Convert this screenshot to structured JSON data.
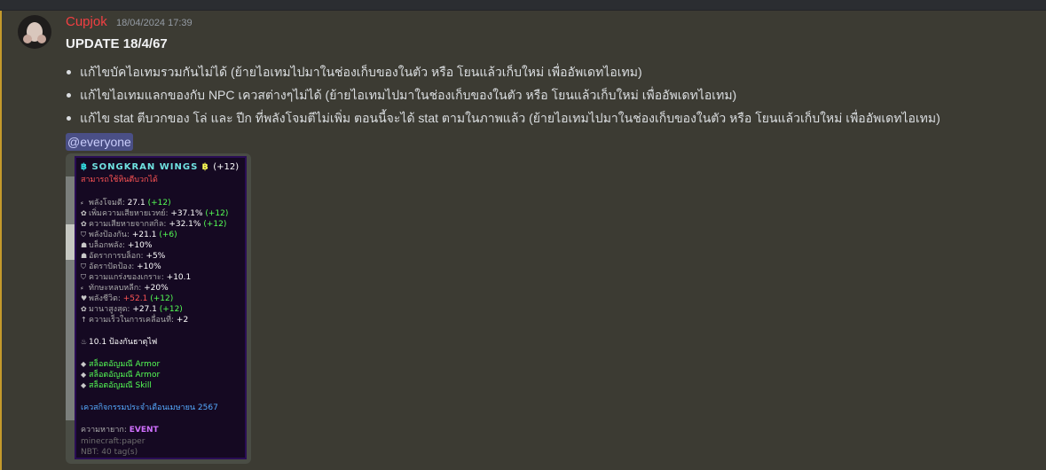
{
  "message": {
    "username": "Cupjok",
    "timestamp": "18/04/2024 17:39",
    "title": "UPDATE 18/4/67",
    "bullets": [
      "แก้ไขบัคไอเทมรวมกันไม่ได้ (ย้ายไอเทมไปมาในช่องเก็บของในตัว หรือ โยนแล้วเก็บใหม่ เพื่ออัพเดทไอเทม)",
      "แก้ไขไอเทมแลกของกับ NPC เควสต่างๆไม่ได้ (ย้ายไอเทมไปมาในช่องเก็บของในตัว หรือ โยนแล้วเก็บใหม่ เพื่ออัพเดทไอเทม)",
      "แก้ไข stat ตีบวกของ โล่ และ ปีก ที่พลังโจมตีไม่เพิ่ม  ตอนนี้จะได้ stat ตามในภาพแล้ว (ย้ายไอเทมไปมาในช่องเก็บของในตัว หรือ โยนแล้วเก็บใหม่ เพื่ออัพเดทไอเทม)"
    ],
    "mention": "@everyone"
  },
  "tooltip": {
    "title_icon": "฿",
    "title_name": "SONGKRAN WINGS",
    "title_icon2": "฿",
    "title_plus": "(+12)",
    "subtitle": "สามารถใช้หินตีบวกได้",
    "stats": [
      {
        "icon": "⸗",
        "label": "พลังโจมตี:",
        "value": "27.1",
        "bonus": "(+12)"
      },
      {
        "icon": "✿",
        "label": "เพิ่มความเสียหายเวทย์:",
        "value": "+37.1%",
        "bonus": "(+12)"
      },
      {
        "icon": "✿",
        "label": "ความเสียหายจากสกิล:",
        "value": "+32.1%",
        "bonus": "(+12)"
      },
      {
        "icon": "⛉",
        "label": "พลังป้องกัน:",
        "value": "+21.1",
        "bonus": "(+6)"
      },
      {
        "icon": "☗",
        "label": "บล็อกพลัง:",
        "value": "+10%",
        "bonus": ""
      },
      {
        "icon": "☗",
        "label": "อัตราการบล็อก:",
        "value": "+5%",
        "bonus": ""
      },
      {
        "icon": "⛉",
        "label": "อัตราปัดป้อง:",
        "value": "+10%",
        "bonus": ""
      },
      {
        "icon": "⛉",
        "label": "ความแกร่งของเกราะ:",
        "value": "+10.1",
        "bonus": ""
      },
      {
        "icon": "⸗",
        "label": "ทักษะหลบหลีก:",
        "value": "+20%",
        "bonus": ""
      },
      {
        "icon": "♥",
        "label": "พลังชีวิต:",
        "value": "+52.1",
        "bonus": "(+12)"
      },
      {
        "icon": "✿",
        "label": "มานาสูงสุด:",
        "value": "+27.1",
        "bonus": "(+12)"
      },
      {
        "icon": "↑",
        "label": "ความเร็วในการเคลื่อนที่:",
        "value": "+2",
        "bonus": ""
      }
    ],
    "fire_icon": "♨",
    "fire_text": "10.1 ป้องกันธาตุไฟ",
    "slots": [
      {
        "icon": "◆",
        "text": "สล็อตอัญมณี Armor"
      },
      {
        "icon": "◆",
        "text": "สล็อตอัญมณี Armor"
      },
      {
        "icon": "◆",
        "text": "สล็อตอัญมณี Skill"
      }
    ],
    "quest": "เควสกิจกรรมประจำเดือนเมษายน 2567",
    "rarity_label": "ความหายาก:",
    "rarity_value": "EVENT",
    "namespace": "minecraft:paper",
    "nbt": "NBT: 40 tag(s)"
  },
  "colors": {
    "username": "#f23f42",
    "accent_bar": "#c49a2b",
    "mention_bg": "#4a4f86",
    "tooltip_bg": "#150922"
  }
}
